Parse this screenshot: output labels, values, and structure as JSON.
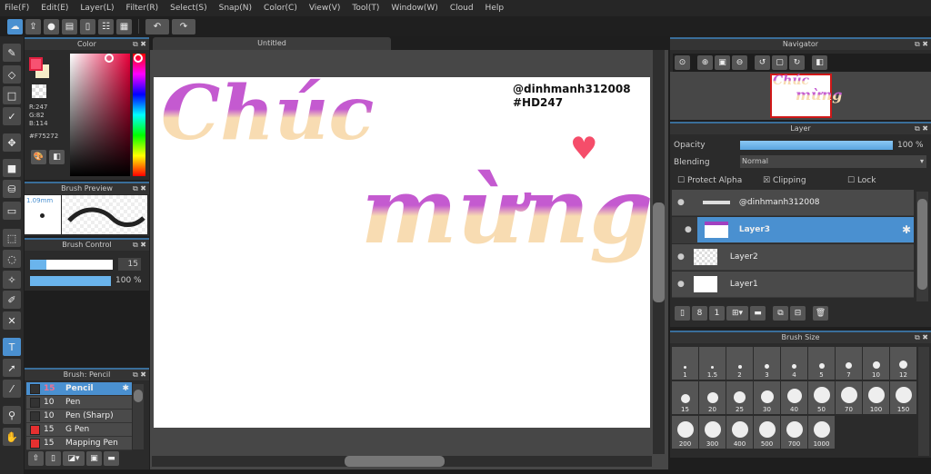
{
  "menu": [
    "File(F)",
    "Edit(E)",
    "Layer(L)",
    "Filter(R)",
    "Select(S)",
    "Snap(N)",
    "Color(C)",
    "View(V)",
    "Tool(T)",
    "Window(W)",
    "Cloud",
    "Help"
  ],
  "toolbar": {
    "icons": [
      "cloud-icon",
      "share-icon",
      "comment-icon",
      "comment-list-icon",
      "page-icon",
      "page-manage-icon",
      "grid-icon"
    ],
    "undo": "↶",
    "redo": "↷"
  },
  "tools": [
    "brush",
    "eraser",
    "rectangle",
    "curve",
    "move",
    "fill-rect",
    "bucket",
    "gradient",
    "select",
    "lasso",
    "magic-wand",
    "select-pen",
    "select-eraser",
    "text",
    "operation",
    "divide",
    "eyedropper",
    "hand"
  ],
  "color_panel": {
    "title": "Color",
    "r": "R:247",
    "g": "G:82",
    "b": "B:114",
    "hex": "#F75272",
    "fg": "#F75272",
    "bg": "#F5EDC8"
  },
  "brush_preview": {
    "title": "Brush Preview",
    "size": "1.09mm"
  },
  "brush_control": {
    "title": "Brush Control",
    "size": "15",
    "opacity": "100 %",
    "size_fraction": 0.2,
    "opacity_fraction": 1.0
  },
  "brush_list": {
    "title": "Brush: Pencil",
    "items": [
      {
        "size": "15",
        "name": "Pencil",
        "color": "#333333",
        "selected": true
      },
      {
        "size": "10",
        "name": "Pen",
        "color": "#333333"
      },
      {
        "size": "10",
        "name": "Pen (Sharp)",
        "color": "#333333"
      },
      {
        "size": "15",
        "name": "G Pen",
        "color": "#e53030"
      },
      {
        "size": "15",
        "name": "Mapping Pen",
        "color": "#e53030"
      }
    ]
  },
  "canvas": {
    "tab": "Untitled",
    "watermark1": "@dinhmanh312008",
    "watermark2": "#HD247",
    "art_word1": "Chúc",
    "art_word2": "mừng"
  },
  "navigator": {
    "title": "Navigator"
  },
  "layer_panel": {
    "title": "Layer",
    "opacity_label": "Opacity",
    "opacity_value": "100 %",
    "blending_label": "Blending",
    "blending_value": "Normal",
    "protect_alpha": "Protect Alpha",
    "clipping": "Clipping",
    "lock": "Lock",
    "layers": [
      {
        "name": "@dinhmanh312008"
      },
      {
        "name": "Layer3",
        "selected": true
      },
      {
        "name": "Layer2"
      },
      {
        "name": "Layer1"
      }
    ]
  },
  "brush_size": {
    "title": "Brush Size",
    "sizes": [
      "1",
      "1.5",
      "2",
      "3",
      "4",
      "5",
      "7",
      "10",
      "12",
      "15",
      "20",
      "25",
      "30",
      "40",
      "50",
      "70",
      "100",
      "150",
      "200",
      "300",
      "400",
      "500",
      "700",
      "1000"
    ]
  }
}
